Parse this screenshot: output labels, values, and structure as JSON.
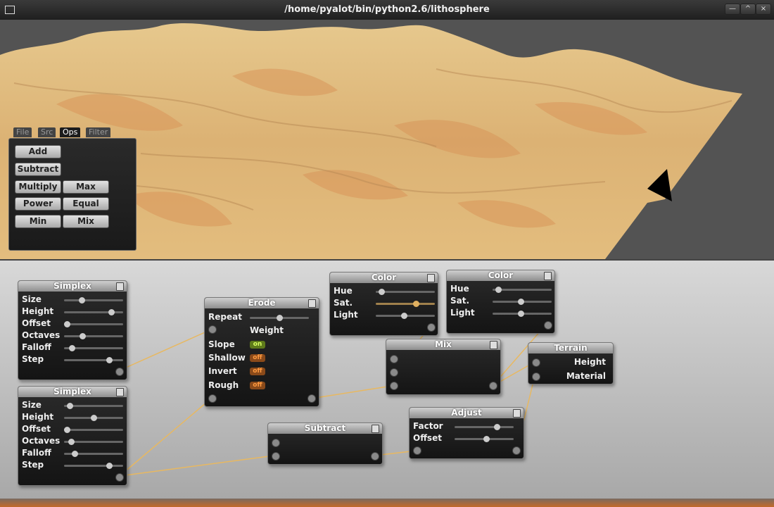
{
  "window": {
    "title": "/home/pyalot/bin/python2.6/lithosphere",
    "minimize_glyph": "—",
    "maximize_glyph": "^",
    "close_glyph": "×"
  },
  "colors": {
    "terrain_light": "#e8c98c",
    "terrain_orange": "#e8a15c",
    "link": "#e8b860",
    "panel_bg": "#1c1c1c"
  },
  "ops_panel": {
    "tabs": [
      {
        "label": "File",
        "active": false
      },
      {
        "label": "Src",
        "active": false
      },
      {
        "label": "Ops",
        "active": true
      },
      {
        "label": "Filter",
        "active": false
      }
    ],
    "buttons": {
      "add": "Add",
      "subtract": "Subtract",
      "multiply": "Multiply",
      "max": "Max",
      "power": "Power",
      "equal": "Equal",
      "min": "Min",
      "mix": "Mix"
    }
  },
  "nodes": {
    "simplex1": {
      "title": "Simplex",
      "rows": [
        {
          "label": "Size",
          "value": 0.3
        },
        {
          "label": "Height",
          "value": 0.8
        },
        {
          "label": "Offset",
          "value": 0.05
        },
        {
          "label": "Octaves",
          "value": 0.31
        },
        {
          "label": "Falloff",
          "value": 0.13
        },
        {
          "label": "Step",
          "value": 0.76
        }
      ]
    },
    "simplex2": {
      "title": "Simplex",
      "rows": [
        {
          "label": "Size",
          "value": 0.1
        },
        {
          "label": "Height",
          "value": 0.5
        },
        {
          "label": "Offset",
          "value": 0.05
        },
        {
          "label": "Octaves",
          "value": 0.12
        },
        {
          "label": "Falloff",
          "value": 0.18
        },
        {
          "label": "Step",
          "value": 0.76
        }
      ]
    },
    "erode": {
      "title": "Erode",
      "repeat_label": "Repeat",
      "repeat_value": 0.5,
      "weight_label": "Weight",
      "toggles": [
        {
          "label": "Slope",
          "state": "on"
        },
        {
          "label": "Shallow",
          "state": "off"
        },
        {
          "label": "Invert",
          "state": "off"
        },
        {
          "label": "Rough",
          "state": "off"
        }
      ]
    },
    "color1": {
      "title": "Color",
      "rows": [
        {
          "label": "Hue",
          "value": 0.1
        },
        {
          "label": "Sat.",
          "value": 0.68
        },
        {
          "label": "Light",
          "value": 0.48
        }
      ]
    },
    "color2": {
      "title": "Color",
      "rows": [
        {
          "label": "Hue",
          "value": 0.1
        },
        {
          "label": "Sat.",
          "value": 0.48
        },
        {
          "label": "Light",
          "value": 0.48
        }
      ]
    },
    "mix": {
      "title": "Mix"
    },
    "terrain": {
      "title": "Terrain",
      "inputs": [
        "Height",
        "Material"
      ]
    },
    "subtract": {
      "title": "Subtract"
    },
    "adjust": {
      "title": "Adjust",
      "rows": [
        {
          "label": "Factor",
          "value": 0.72
        },
        {
          "label": "Offset",
          "value": 0.54
        }
      ]
    }
  }
}
